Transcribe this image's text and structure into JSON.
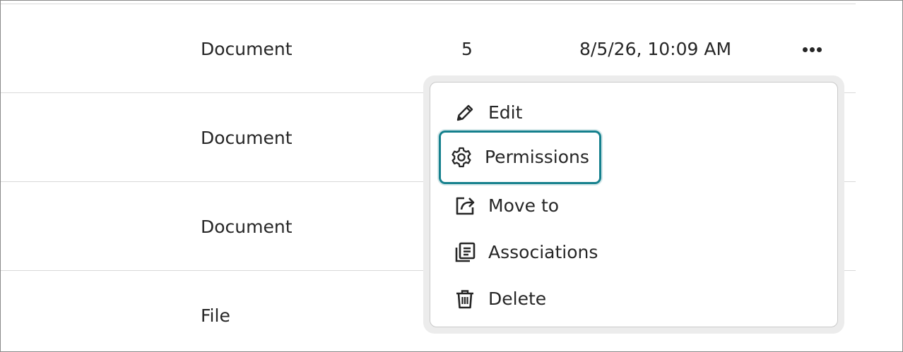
{
  "rows": [
    {
      "type": "Document",
      "count": "5",
      "date": "8/5/26, 10:09 AM"
    },
    {
      "type": "Document"
    },
    {
      "type": "Document"
    },
    {
      "type": "File"
    }
  ],
  "row_actions": {
    "more_icon": "more-horizontal-icon"
  },
  "context_menu": {
    "items": [
      {
        "label": "Edit",
        "icon": "pencil-icon"
      },
      {
        "label": "Permissions",
        "icon": "gear-icon",
        "focused": true
      },
      {
        "label": "Move to",
        "icon": "move-to-icon"
      },
      {
        "label": "Associations",
        "icon": "associations-icon"
      },
      {
        "label": "Delete",
        "icon": "trash-icon"
      }
    ],
    "focus_color": "#15808d"
  }
}
